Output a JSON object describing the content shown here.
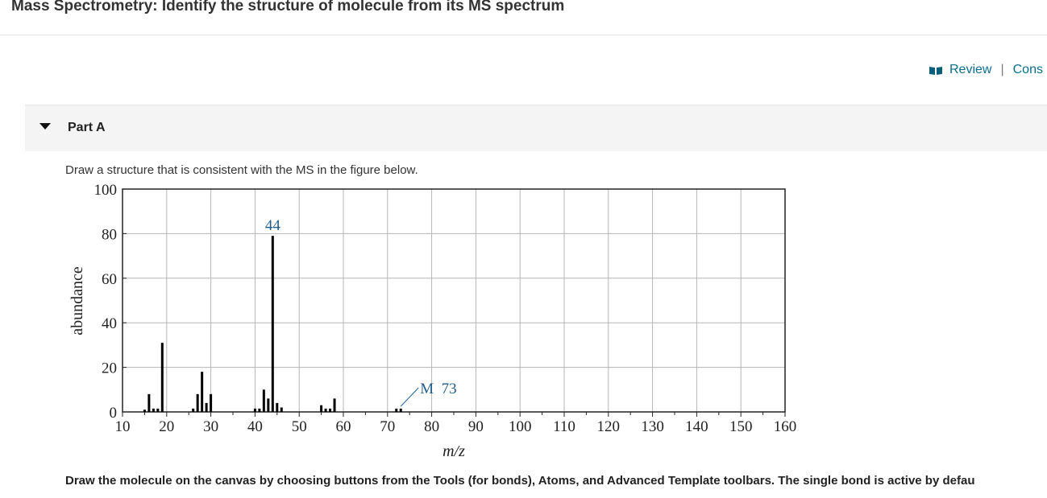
{
  "header": {
    "title": "Mass Spectrometry: Identify the structure of molecule from its MS spectrum"
  },
  "top_links": {
    "review": "Review",
    "separator": "|",
    "constants": "Cons",
    "icon": "book-icon"
  },
  "part": {
    "label": "Part A",
    "icon": "caret-down-icon"
  },
  "question": {
    "prompt": "Draw a structure that is consistent with the MS in the figure below.",
    "instructions": "Draw the molecule on the canvas by choosing buttons from the Tools (for bonds), Atoms, and Advanced Template toolbars. The single bond is active by defau"
  },
  "colors": {
    "link": "#0b6e8c",
    "annotation": "#1f5c8b",
    "bars": "#000000",
    "grid": "#b5b5b5"
  },
  "chart_data": {
    "type": "bar",
    "title": "",
    "xlabel": "m/z",
    "ylabel": "abundance",
    "xlim": [
      10,
      160
    ],
    "ylim": [
      0,
      100
    ],
    "grid": true,
    "x_ticks": [
      10,
      20,
      30,
      40,
      50,
      60,
      70,
      80,
      90,
      100,
      110,
      120,
      130,
      140,
      150,
      160
    ],
    "y_ticks": [
      0,
      20,
      40,
      60,
      80,
      100
    ],
    "peaks": [
      {
        "mz": 15,
        "abundance": 1
      },
      {
        "mz": 16,
        "abundance": 8
      },
      {
        "mz": 17,
        "abundance": 1.5
      },
      {
        "mz": 18,
        "abundance": 1.5
      },
      {
        "mz": 19,
        "abundance": 31
      },
      {
        "mz": 26,
        "abundance": 1.5
      },
      {
        "mz": 27,
        "abundance": 8
      },
      {
        "mz": 28,
        "abundance": 18
      },
      {
        "mz": 29,
        "abundance": 4
      },
      {
        "mz": 30,
        "abundance": 8
      },
      {
        "mz": 40,
        "abundance": 1.5
      },
      {
        "mz": 41,
        "abundance": 1.5
      },
      {
        "mz": 42,
        "abundance": 10
      },
      {
        "mz": 43,
        "abundance": 6
      },
      {
        "mz": 44,
        "abundance": 79
      },
      {
        "mz": 45,
        "abundance": 4
      },
      {
        "mz": 46,
        "abundance": 2
      },
      {
        "mz": 55,
        "abundance": 3
      },
      {
        "mz": 56,
        "abundance": 1.5
      },
      {
        "mz": 57,
        "abundance": 1.5
      },
      {
        "mz": 58,
        "abundance": 6
      },
      {
        "mz": 72,
        "abundance": 1.5
      },
      {
        "mz": 73,
        "abundance": 1.5
      }
    ],
    "annotations": [
      {
        "text": "44",
        "mz": 44
      },
      {
        "text": "M  73",
        "mz": 73
      }
    ]
  }
}
